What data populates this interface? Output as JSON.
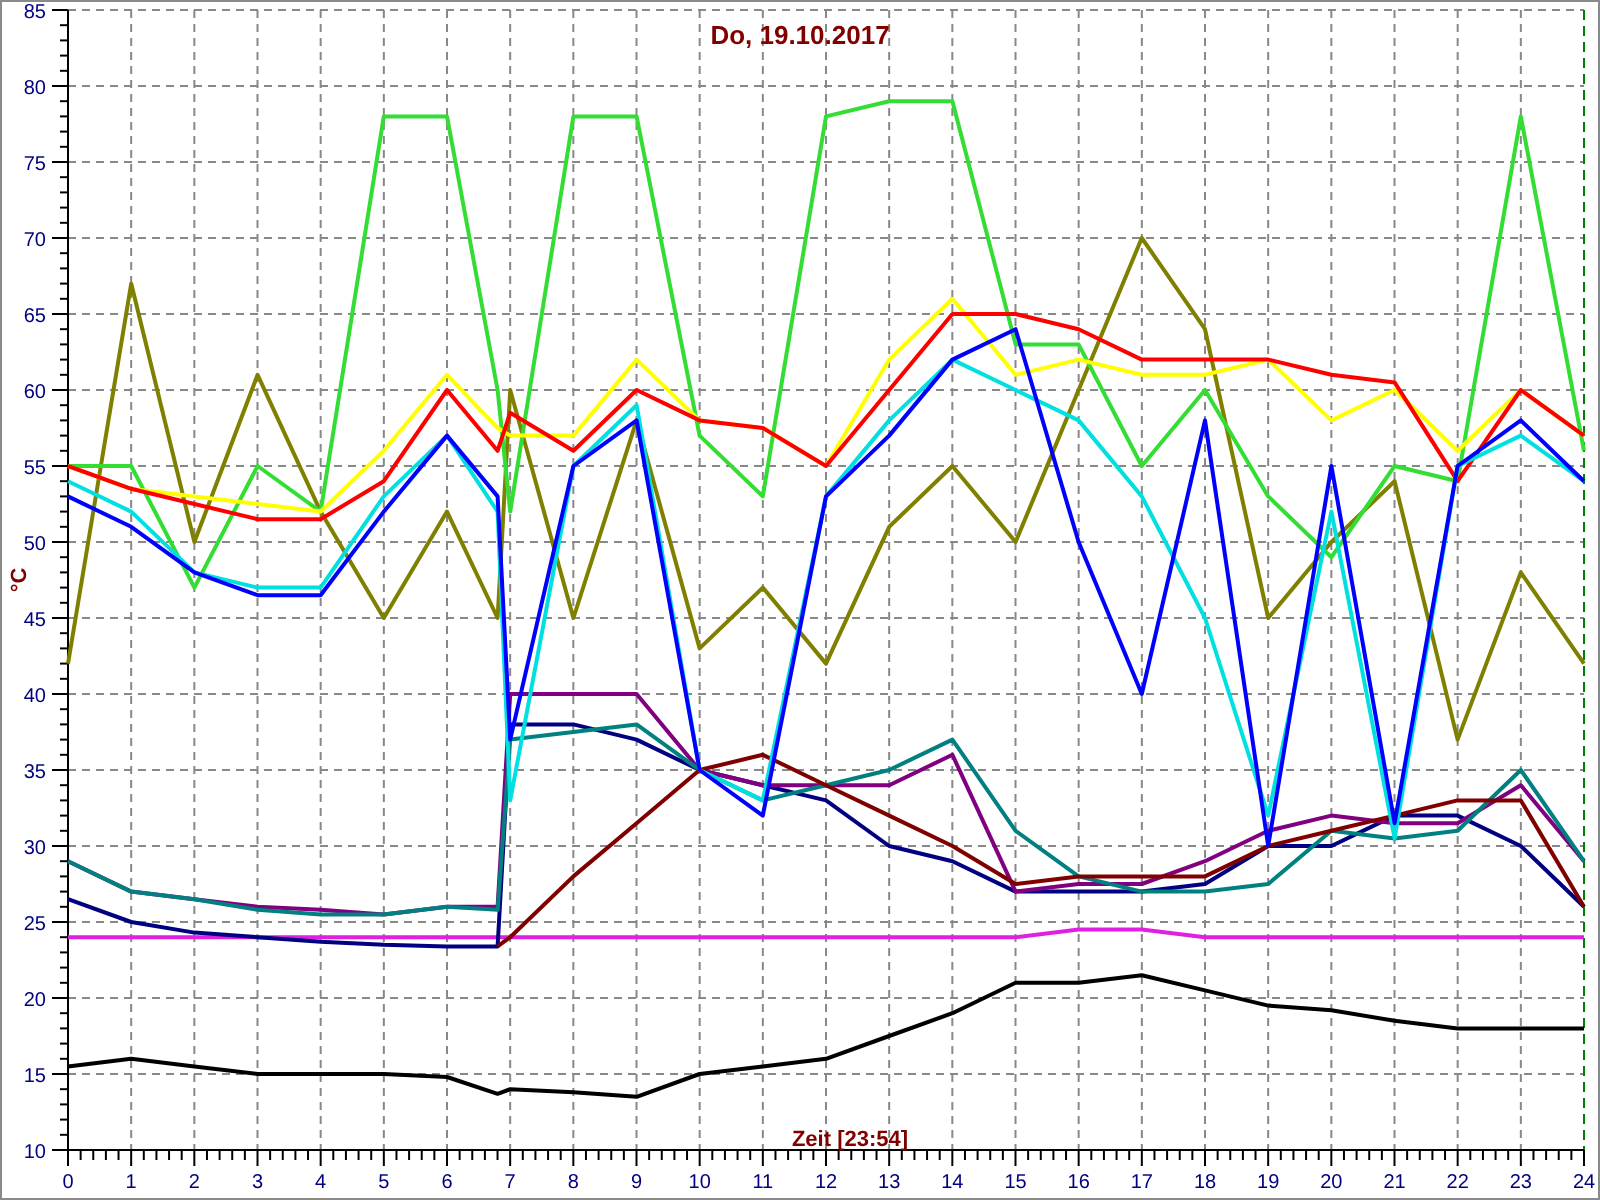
{
  "chart": {
    "chart_data": {
      "type": "line",
      "title": "Do, 19.10.2017",
      "xlabel": "Zeit [23:54]",
      "ylabel": "°C",
      "x": [
        0,
        1,
        2,
        3,
        4,
        5,
        6,
        6.8,
        7,
        8,
        9,
        10,
        11,
        12,
        13,
        14,
        15,
        16,
        17,
        18,
        19,
        20,
        21,
        22,
        23,
        24
      ],
      "series": [
        {
          "color": "#000000",
          "values": [
            15.5,
            16,
            15.5,
            15,
            15,
            15,
            14.8,
            13.7,
            14,
            13.8,
            13.5,
            15,
            15.5,
            16,
            17.5,
            19,
            21,
            21,
            21.5,
            20.5,
            19.5,
            19.2,
            18.5,
            18,
            18,
            18
          ]
        },
        {
          "color": "#e020e0",
          "values": [
            24,
            24,
            24,
            24,
            24,
            24,
            24,
            24,
            24,
            24,
            24,
            24,
            24,
            24,
            24,
            24,
            24,
            24.5,
            24.5,
            24,
            24,
            24,
            24,
            24,
            24,
            24
          ]
        },
        {
          "color": "#000080",
          "values": [
            26.5,
            25,
            24.3,
            24,
            23.7,
            23.5,
            23.4,
            23.4,
            38,
            38,
            37,
            35,
            34,
            33,
            30,
            29,
            27,
            27,
            27,
            27.5,
            30,
            30,
            32,
            32,
            30,
            26
          ]
        },
        {
          "color": "#800080",
          "values": [
            29,
            27,
            26.5,
            26,
            25.8,
            25.5,
            26,
            26,
            40,
            40,
            40,
            35,
            34,
            34,
            34,
            36,
            27,
            27.5,
            27.5,
            29,
            31,
            32,
            31.5,
            31.5,
            34,
            29
          ]
        },
        {
          "color": "#008080",
          "values": [
            29,
            27,
            26.5,
            25.8,
            25.5,
            25.5,
            26,
            25.8,
            37,
            37.5,
            38,
            35,
            33,
            34,
            35,
            37,
            31,
            28,
            27,
            27,
            27.5,
            31,
            30.5,
            31,
            35,
            29
          ]
        },
        {
          "color": "#800000",
          "values": [
            null,
            null,
            null,
            null,
            null,
            null,
            null,
            23.4,
            24,
            28,
            31.5,
            35,
            36,
            34,
            32,
            30,
            27.5,
            28,
            28,
            28,
            30,
            31,
            32,
            33,
            33,
            26
          ]
        },
        {
          "color": "#808000",
          "values": [
            42,
            67,
            50,
            61,
            52,
            45,
            52,
            45,
            60,
            45,
            58,
            43,
            47,
            42,
            51,
            55,
            50,
            60,
            70,
            64,
            45,
            50,
            54,
            37,
            48,
            42
          ]
        },
        {
          "color": "#33dd33",
          "values": [
            55,
            55,
            47,
            55,
            52,
            78,
            78,
            60,
            52,
            78,
            78,
            57,
            53,
            78,
            79,
            79,
            63,
            63,
            55,
            60,
            53,
            49,
            55,
            54,
            78,
            56
          ]
        },
        {
          "color": "#ffff00",
          "values": [
            55,
            53.5,
            53,
            52.5,
            52,
            56,
            61,
            57.5,
            57,
            57,
            62,
            58,
            57.5,
            55,
            62,
            66,
            61,
            62,
            61,
            61,
            62,
            58,
            60,
            56,
            60,
            57
          ]
        },
        {
          "color": "#ff0000",
          "values": [
            55,
            53.5,
            52.5,
            51.5,
            51.5,
            54,
            60,
            56,
            58.5,
            56,
            60,
            58,
            57.5,
            55,
            60,
            65,
            65,
            64,
            62,
            62,
            62,
            61,
            60.5,
            54,
            60,
            57
          ]
        },
        {
          "color": "#00e0e0",
          "values": [
            54,
            52,
            48,
            47,
            47,
            53,
            57,
            52,
            33,
            55,
            59,
            35,
            33,
            53,
            58,
            62,
            60,
            58,
            53,
            45,
            32,
            52,
            30.5,
            55,
            57,
            54
          ]
        },
        {
          "color": "#0000ff",
          "values": [
            53,
            51,
            48,
            46.5,
            46.5,
            52,
            57,
            53,
            37,
            55,
            58,
            35,
            32,
            53,
            57,
            62,
            64,
            50,
            40,
            58,
            30,
            55,
            31.5,
            55,
            58,
            54
          ]
        }
      ],
      "grid": true,
      "xlim": [
        0,
        24
      ],
      "ylim": [
        10,
        85
      ],
      "xticks": [
        0,
        1,
        2,
        3,
        4,
        5,
        6,
        7,
        8,
        9,
        10,
        11,
        12,
        13,
        14,
        15,
        16,
        17,
        18,
        19,
        20,
        21,
        22,
        23,
        24
      ],
      "yticks": [
        10,
        15,
        20,
        25,
        30,
        35,
        40,
        45,
        50,
        55,
        60,
        65,
        70,
        75,
        80,
        85
      ]
    }
  }
}
